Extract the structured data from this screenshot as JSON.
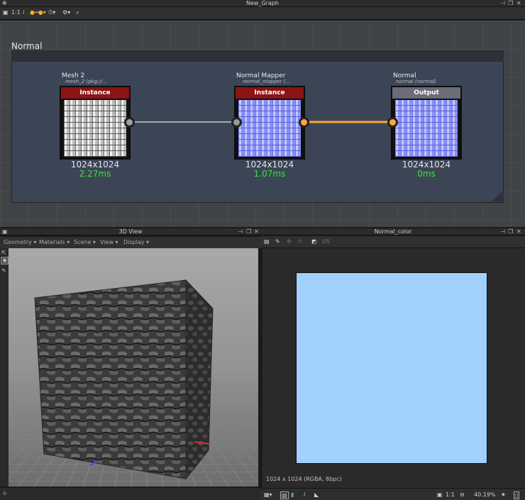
{
  "graph_window": {
    "title": "New_Graph",
    "toolbar": {
      "fit_label": "1:1",
      "info_label": "i"
    },
    "frame_title": "Normal",
    "nodes": [
      {
        "title": "Mesh 2",
        "subtitle": "mesh_2 (pkg://...",
        "header": "Instance",
        "resolution": "1024x1024",
        "time": "2.27ms"
      },
      {
        "title": "Normal Mapper",
        "subtitle": "normal_mapper (...",
        "header": "Instance",
        "resolution": "1024x1024",
        "time": "1.07ms"
      },
      {
        "title": "Normal",
        "subtitle": "normal (normal)",
        "header": "Output",
        "resolution": "1024x1024",
        "time": "0ms"
      }
    ]
  },
  "view3d_window": {
    "title": "3D View",
    "menu": [
      "Geometry",
      "Materials",
      "Scene",
      "View",
      "Display"
    ]
  },
  "image_window": {
    "title": "Normal_color",
    "toolbar": {
      "uv_label": "UV"
    },
    "info": "1024 x 1024 (RGBA, 8bpc)",
    "status": {
      "fit_label": "1:1",
      "zoom": "40.19%"
    },
    "swatch_color": "#a2d0fd"
  },
  "colors": {
    "accent_orange": "#f7a935",
    "instance_red": "#8b1414",
    "time_green": "#3de33d"
  }
}
